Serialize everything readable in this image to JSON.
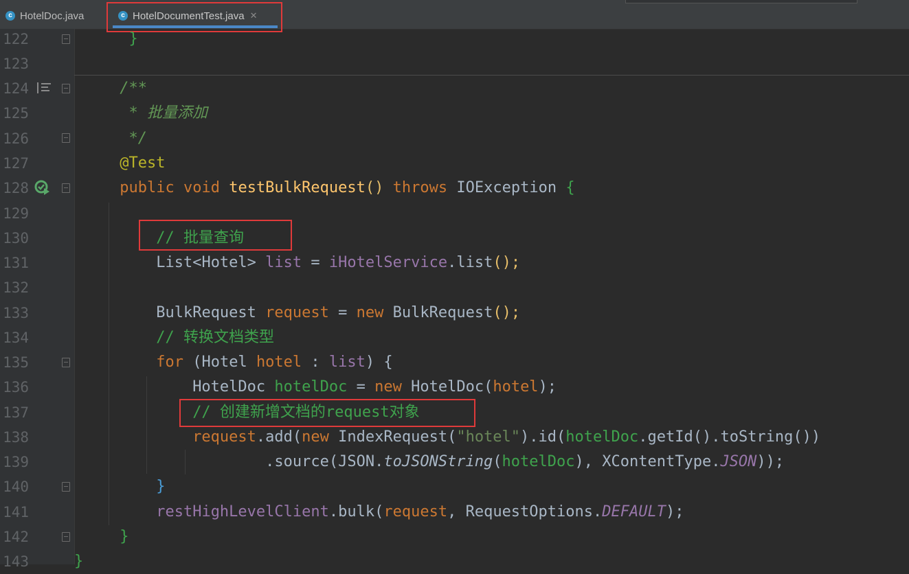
{
  "tabs": [
    {
      "label": "HotelDoc.java",
      "icon": "java-class-icon"
    },
    {
      "label": "HotelDocumentTest.java",
      "icon": "java-test-class-icon",
      "active": true
    }
  ],
  "line_numbers": [
    "122",
    "123",
    "124",
    "125",
    "126",
    "127",
    "128",
    "129",
    "130",
    "131",
    "132",
    "133",
    "134",
    "135",
    "136",
    "137",
    "138",
    "139",
    "140",
    "141",
    "142",
    "143"
  ],
  "code": {
    "l122": "}",
    "l124": "/**",
    "l125_star": " * ",
    "l125_text": "批量添加",
    "l126": " */",
    "l127": "@Test",
    "l128_public": "public",
    "l128_void": "void",
    "l128_name": "testBulkRequest",
    "l128_parens": "()",
    "l128_throws": "throws",
    "l128_ex": "IOException",
    "l128_brace": "{",
    "l130": "// 批量查询",
    "l131_type": "List<Hotel>",
    "l131_var": "list",
    "l131_eq": " = ",
    "l131_field": "iHotelService",
    "l131_call": ".list",
    "l131_end": "();",
    "l133_type": "BulkRequest",
    "l133_var": "request",
    "l133_eq": " = ",
    "l133_new": "new",
    "l133_ctor": " BulkRequest",
    "l133_end": "();",
    "l134": "// 转换文档类型",
    "l135_for": "for",
    "l135_open": " (Hotel ",
    "l135_var": "hotel",
    "l135_colon": " : ",
    "l135_list": "list",
    "l135_close": ") {",
    "l136_type": "HotelDoc",
    "l136_var": "hotelDoc",
    "l136_eq": " = ",
    "l136_new": "new",
    "l136_ctor": " HotelDoc(",
    "l136_arg": "hotel",
    "l136_end": ");",
    "l137": "// 创建新增文档的request对象",
    "l138_var": "request",
    "l138_add": ".add(",
    "l138_new": "new",
    "l138_ctor": " IndexRequest(",
    "l138_str": "\"hotel\"",
    "l138_id": ").id(",
    "l138_doc": "hotelDoc",
    "l138_rest": ".getId().toString())",
    "l139_src": ".source(JSON.",
    "l139_fn": "toJSONString",
    "l139_open": "(",
    "l139_doc": "hotelDoc",
    "l139_mid": "), XContentType.",
    "l139_const": "JSON",
    "l139_end": "));",
    "l140": "}",
    "l141_field": "restHighLevelClient",
    "l141_call": ".bulk(",
    "l141_var": "request",
    "l141_mid": ", RequestOptions.",
    "l141_const": "DEFAULT",
    "l141_end": ");",
    "l142": "}",
    "l143": "}"
  },
  "colors": {
    "background": "#2b2b2b",
    "keyword": "#cc7832",
    "method": "#ffc66d",
    "annotation": "#bbb529",
    "field": "#9876aa",
    "comment": "#629755",
    "highlight_box": "#e03a3a"
  }
}
